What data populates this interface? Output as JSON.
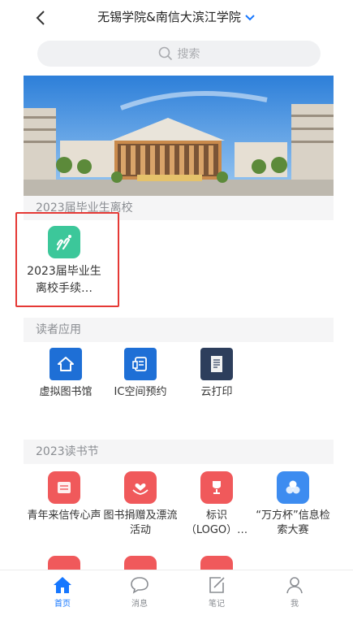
{
  "header": {
    "title": "无锡学院&南信大滨江学院"
  },
  "search": {
    "placeholder": "搜索"
  },
  "sections": {
    "graduation": "2023届毕业生离校",
    "reader_apps": "读者应用",
    "reading_festival": "2023读书节"
  },
  "graduation_apps": [
    {
      "label": "2023届毕业生离校手续…",
      "icon": "graduation-icon",
      "color": "#3cc79a"
    }
  ],
  "reader_apps": [
    {
      "label": "虚拟图书馆",
      "icon": "home-icon",
      "color": "#1e6fd6"
    },
    {
      "label": "IC空间预约",
      "icon": "booking-icon",
      "color": "#1e6fd6"
    },
    {
      "label": "云打印",
      "icon": "print-icon",
      "color": "#2d3e5c"
    }
  ],
  "festival_apps": [
    {
      "label": "青年来信传心声",
      "icon": "letter-icon",
      "color": "#f0595b"
    },
    {
      "label": "图书捐赠及漂流活动",
      "icon": "donate-icon",
      "color": "#f0595b"
    },
    {
      "label": "标识（LOGO）…",
      "icon": "trophy-icon",
      "color": "#f0595b"
    },
    {
      "label": "“万方杯”信息检索大赛",
      "icon": "contest-icon",
      "color": "#3d8cf0"
    }
  ],
  "tabbar": [
    {
      "label": "首页",
      "icon": "home-tab-icon"
    },
    {
      "label": "消息",
      "icon": "message-icon"
    },
    {
      "label": "笔记",
      "icon": "note-icon"
    },
    {
      "label": "我",
      "icon": "user-icon"
    }
  ],
  "active_tab": "首页",
  "accent_color": "#1677ff"
}
